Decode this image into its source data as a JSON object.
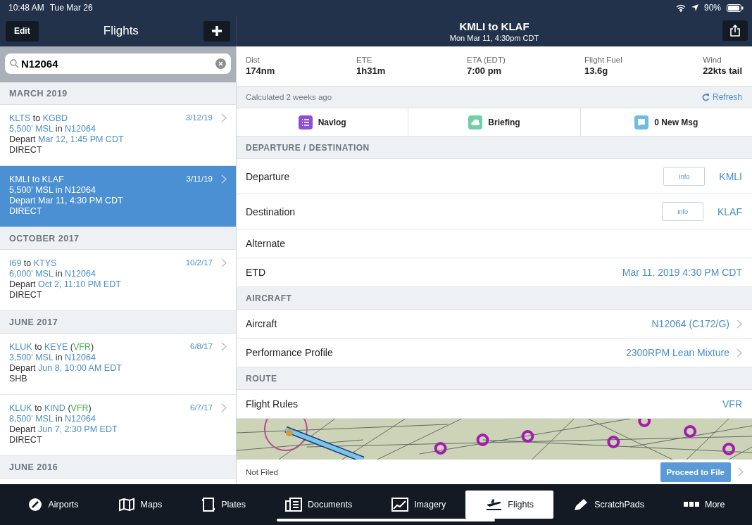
{
  "status_bar": {
    "time": "10:48 AM",
    "date": "Tue Mar 26",
    "battery": "90%"
  },
  "sidebar": {
    "edit_button": "Edit",
    "title": "Flights",
    "search": {
      "value": "N12064"
    },
    "sections": [
      {
        "title": "MARCH 2019",
        "flights": [
          {
            "selected": false,
            "date": "3/12/19",
            "lines": [
              [
                {
                  "kind": "link",
                  "text": "KLTS"
                },
                {
                  "kind": "plain",
                  "text": " to "
                },
                {
                  "kind": "link",
                  "text": "KGBD"
                }
              ],
              [
                {
                  "kind": "link",
                  "text": "5,500' MSL"
                },
                {
                  "kind": "plain",
                  "text": " in "
                },
                {
                  "kind": "link",
                  "text": "N12064"
                }
              ],
              [
                {
                  "kind": "plain",
                  "text": "Depart "
                },
                {
                  "kind": "link",
                  "text": "Mar 12, 1:45 PM CDT"
                }
              ],
              [
                {
                  "kind": "plain",
                  "text": "DIRECT"
                }
              ]
            ]
          },
          {
            "selected": true,
            "date": "3/11/19",
            "lines": [
              [
                {
                  "kind": "link",
                  "text": "KMLI"
                },
                {
                  "kind": "plain",
                  "text": " to "
                },
                {
                  "kind": "link",
                  "text": "KLAF"
                }
              ],
              [
                {
                  "kind": "link",
                  "text": "5,500' MSL"
                },
                {
                  "kind": "plain",
                  "text": " in "
                },
                {
                  "kind": "link",
                  "text": "N12064"
                }
              ],
              [
                {
                  "kind": "plain",
                  "text": "Depart "
                },
                {
                  "kind": "link",
                  "text": "Mar 11, 4:30 PM CDT"
                }
              ],
              [
                {
                  "kind": "plain",
                  "text": "DIRECT"
                }
              ]
            ]
          }
        ]
      },
      {
        "title": "OCTOBER 2017",
        "flights": [
          {
            "selected": false,
            "date": "10/2/17",
            "lines": [
              [
                {
                  "kind": "link",
                  "text": "I69"
                },
                {
                  "kind": "plain",
                  "text": " to "
                },
                {
                  "kind": "link",
                  "text": "KTYS"
                }
              ],
              [
                {
                  "kind": "link",
                  "text": "6,000' MSL"
                },
                {
                  "kind": "plain",
                  "text": " in "
                },
                {
                  "kind": "link",
                  "text": "N12064"
                }
              ],
              [
                {
                  "kind": "plain",
                  "text": "Depart "
                },
                {
                  "kind": "link",
                  "text": "Oct 2, 11:10 PM EDT"
                }
              ],
              [
                {
                  "kind": "plain",
                  "text": "DIRECT"
                }
              ]
            ]
          }
        ]
      },
      {
        "title": "JUNE 2017",
        "flights": [
          {
            "selected": false,
            "date": "6/8/17",
            "lines": [
              [
                {
                  "kind": "link",
                  "text": "KLUK"
                },
                {
                  "kind": "plain",
                  "text": " to "
                },
                {
                  "kind": "link",
                  "text": "KEYE"
                },
                {
                  "kind": "plain",
                  "text": " ("
                },
                {
                  "kind": "rules",
                  "text": "VFR"
                },
                {
                  "kind": "plain",
                  "text": ")"
                }
              ],
              [
                {
                  "kind": "link",
                  "text": "3,500' MSL"
                },
                {
                  "kind": "plain",
                  "text": " in "
                },
                {
                  "kind": "link",
                  "text": "N12064"
                }
              ],
              [
                {
                  "kind": "plain",
                  "text": "Depart "
                },
                {
                  "kind": "link",
                  "text": "Jun 8, 10:00 AM EDT"
                }
              ],
              [
                {
                  "kind": "plain",
                  "text": "SHB"
                }
              ]
            ]
          },
          {
            "selected": false,
            "date": "6/7/17",
            "lines": [
              [
                {
                  "kind": "link",
                  "text": "KLUK"
                },
                {
                  "kind": "plain",
                  "text": " to "
                },
                {
                  "kind": "link",
                  "text": "KIND"
                },
                {
                  "kind": "plain",
                  "text": " ("
                },
                {
                  "kind": "rules",
                  "text": "VFR"
                },
                {
                  "kind": "plain",
                  "text": ")"
                }
              ],
              [
                {
                  "kind": "link",
                  "text": "8,500' MSL"
                },
                {
                  "kind": "plain",
                  "text": " in "
                },
                {
                  "kind": "link",
                  "text": "N12064"
                }
              ],
              [
                {
                  "kind": "plain",
                  "text": "Depart "
                },
                {
                  "kind": "link",
                  "text": "Jun 7, 2:30 PM EDT"
                }
              ],
              [
                {
                  "kind": "plain",
                  "text": "DIRECT"
                }
              ]
            ]
          }
        ]
      },
      {
        "title": "JUNE 2016"
      }
    ]
  },
  "detail": {
    "title": "KMLI to KLAF",
    "subtitle": "Mon Mar 11, 4:30pm CDT",
    "stats": [
      {
        "label": "Dist",
        "value": "174nm"
      },
      {
        "label": "ETE",
        "value": "1h31m"
      },
      {
        "label": "ETA (EDT)",
        "value": "7:00 pm"
      },
      {
        "label": "Flight Fuel",
        "value": "13.6g"
      },
      {
        "label": "Wind",
        "value": "22kts tail"
      }
    ],
    "calculated": "Calculated 2 weeks ago",
    "refresh": "Refresh",
    "actions": [
      {
        "label": "Navlog",
        "color": "#8e4fd6"
      },
      {
        "label": "Briefing",
        "color": "#6fd0a8"
      },
      {
        "label": "0 New Msg",
        "color": "#6bbde3"
      }
    ],
    "sections": [
      {
        "title": "DEPARTURE / DESTINATION",
        "rows": [
          {
            "kind": "airport",
            "label": "Departure",
            "button": "Info",
            "value": "KMLI"
          },
          {
            "kind": "airport",
            "label": "Destination",
            "button": "Info",
            "value": "KLAF"
          },
          {
            "kind": "plain",
            "label": "Alternate"
          },
          {
            "kind": "value",
            "label": "ETD",
            "value": "Mar 11, 2019 4:30 PM CDT"
          }
        ]
      },
      {
        "title": "AIRCRAFT",
        "rows": [
          {
            "kind": "link",
            "label": "Aircraft",
            "value": "N12064 (C172/G)"
          },
          {
            "kind": "link",
            "label": "Performance Profile",
            "value": "2300RPM Lean Mixture"
          }
        ]
      },
      {
        "title": "ROUTE",
        "rows": [
          {
            "kind": "value",
            "label": "Flight Rules",
            "value": "VFR"
          }
        ]
      }
    ],
    "filing": {
      "status": "Not Filed",
      "button": "Proceed to File"
    }
  },
  "tabs": [
    {
      "label": "Airports",
      "selected": false
    },
    {
      "label": "Maps",
      "selected": false
    },
    {
      "label": "Plates",
      "selected": false
    },
    {
      "label": "Documents",
      "selected": false
    },
    {
      "label": "Imagery",
      "selected": false
    },
    {
      "label": "Flights",
      "selected": true
    },
    {
      "label": "ScratchPads",
      "selected": false
    },
    {
      "label": "More",
      "selected": false
    }
  ]
}
